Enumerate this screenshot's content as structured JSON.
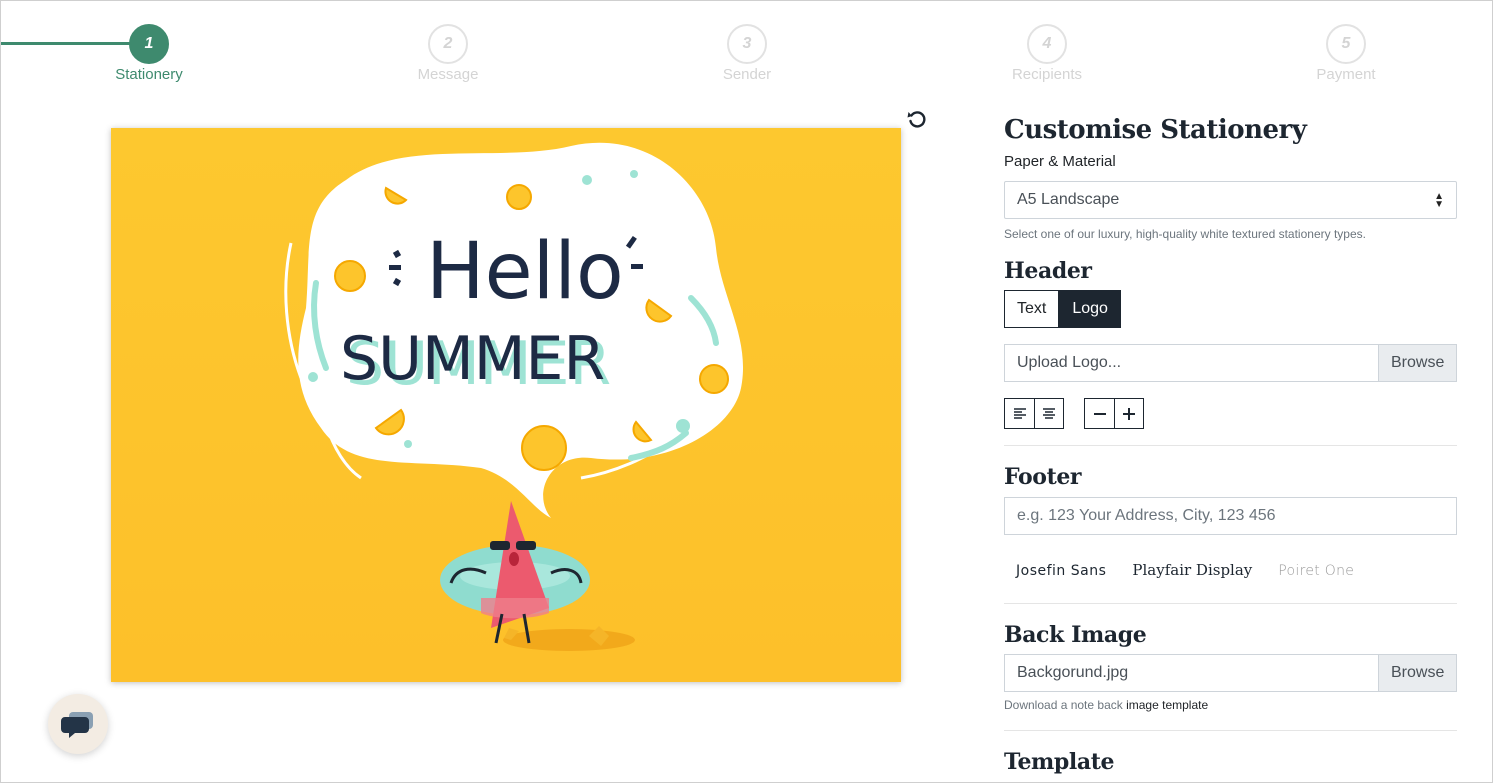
{
  "stepper": {
    "steps": [
      {
        "number": "1",
        "label": "Stationery",
        "active": true
      },
      {
        "number": "2",
        "label": "Message",
        "active": false
      },
      {
        "number": "3",
        "label": "Sender",
        "active": false
      },
      {
        "number": "4",
        "label": "Recipients",
        "active": false
      },
      {
        "number": "5",
        "label": "Payment",
        "active": false
      }
    ],
    "accent_color": "#3e8a6e"
  },
  "preview": {
    "line1": "Hello",
    "line2": "SUMMER",
    "background_color": "#fdc52c",
    "undo_icon": "rotate-ccw-icon"
  },
  "panel": {
    "title": "Customise Stationery",
    "paper_label": "Paper & Material",
    "paper_value": "A5 Landscape",
    "paper_hint": "Select one of our luxury, high-quality white textured stationery types.",
    "header_title": "Header",
    "header_toggle": {
      "text": "Text",
      "logo": "Logo",
      "selected": "Logo"
    },
    "upload_placeholder": "Upload Logo...",
    "browse_label": "Browse",
    "footer_title": "Footer",
    "footer_placeholder": "e.g. 123 Your Address, City, 123 456",
    "fonts": [
      "Josefin Sans",
      "Playfair Display",
      "Poiret One"
    ],
    "back_image_title": "Back Image",
    "back_image_value": "Backgorund.jpg",
    "back_browse_label": "Browse",
    "back_hint_prefix": "Download a note back",
    "back_hint_link": "image template",
    "template_title": "Template"
  },
  "chat": {
    "icon": "chat-bubble-icon"
  }
}
